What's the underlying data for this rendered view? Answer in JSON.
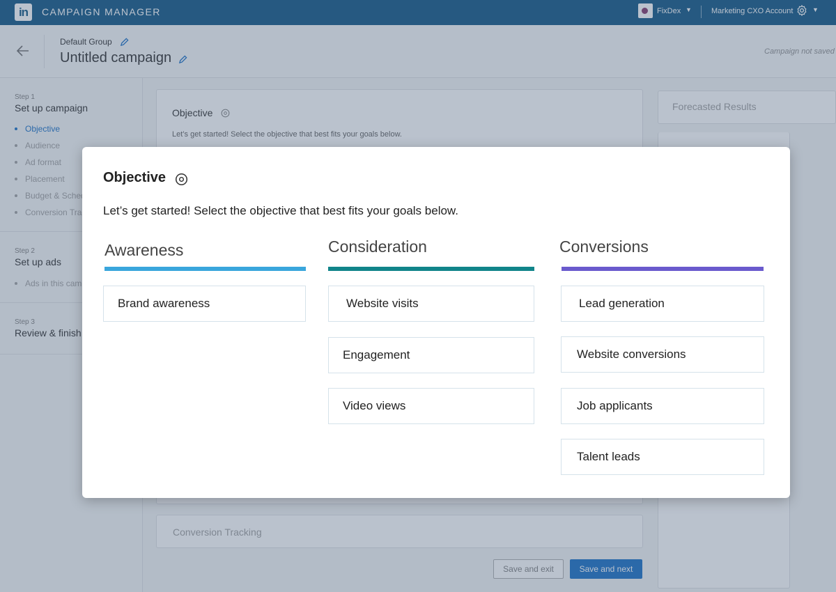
{
  "topbar": {
    "logo_text": "in",
    "app_title": "CAMPAIGN MANAGER",
    "account_name": "FixDex",
    "account_type": "Marketing CXO Account",
    "icons": [
      "linkedin-logo",
      "gear-icon",
      "caret-down-icon"
    ]
  },
  "header": {
    "group_name": "Default Group",
    "campaign_name": "Untitled campaign",
    "save_status": "Campaign not saved"
  },
  "sidebar": {
    "steps": [
      {
        "number": "Step 1",
        "title": "Set up campaign",
        "items": [
          "Objective",
          "Audience",
          "Ad format",
          "Placement",
          "Budget & Schedule",
          "Conversion Tracking"
        ]
      },
      {
        "number": "Step 2",
        "title": "Set up ads",
        "items": [
          "Ads in this campaign"
        ]
      },
      {
        "number": "Step 3",
        "title": "Review & finish",
        "items": []
      }
    ]
  },
  "main": {
    "objective_title": "Objective",
    "objective_sub": "Let’s get started! Select the objective that best fits your goals below.",
    "forecast_title": "Forecasted Results",
    "conversion_tracking": "Conversion Tracking",
    "save_exit": "Save and exit",
    "save_next": "Save and next"
  },
  "modal": {
    "title": "Objective",
    "subtitle": "Let’s get started! Select the objective that best fits your goals below.",
    "columns": [
      {
        "heading": "Awareness",
        "color": "#3aa6dc",
        "options": [
          "Brand awareness"
        ]
      },
      {
        "heading": "Consideration",
        "color": "#11858a",
        "options": [
          "Website visits",
          "Engagement",
          "Video views"
        ]
      },
      {
        "heading": "Conversions",
        "color": "#6a5acd",
        "options": [
          "Lead generation",
          "Website conversions",
          "Job applicants",
          "Talent leads"
        ]
      }
    ]
  }
}
